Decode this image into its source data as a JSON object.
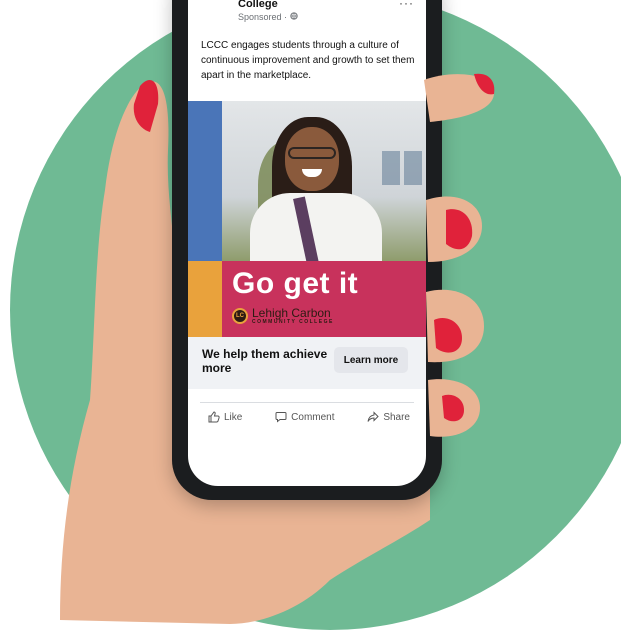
{
  "post": {
    "page_name": "College",
    "sponsored_label": "Sponsored ·",
    "more_icon": "···",
    "body_text": "LCCC engages students through a culture of continuous improvement and growth to set them apart in the marketplace."
  },
  "ad": {
    "tagline": "Go get it",
    "college_name": "Lehigh Carbon",
    "college_sub": "COMMUNITY COLLEGE",
    "logo_mark": "LC"
  },
  "cta": {
    "headline": "We help them achieve more",
    "button_label": "Learn more"
  },
  "actions": {
    "like_label": "Like",
    "comment_label": "Comment",
    "share_label": "Share"
  },
  "colors": {
    "background_circle": "#6fba94",
    "brand_pink": "#c8325c",
    "brand_blue": "#4a75b8",
    "brand_orange": "#e9a23c",
    "nail_red": "#e0223a"
  },
  "icons": [
    "globe-icon",
    "more-icon",
    "like-icon",
    "comment-icon",
    "share-icon"
  ]
}
